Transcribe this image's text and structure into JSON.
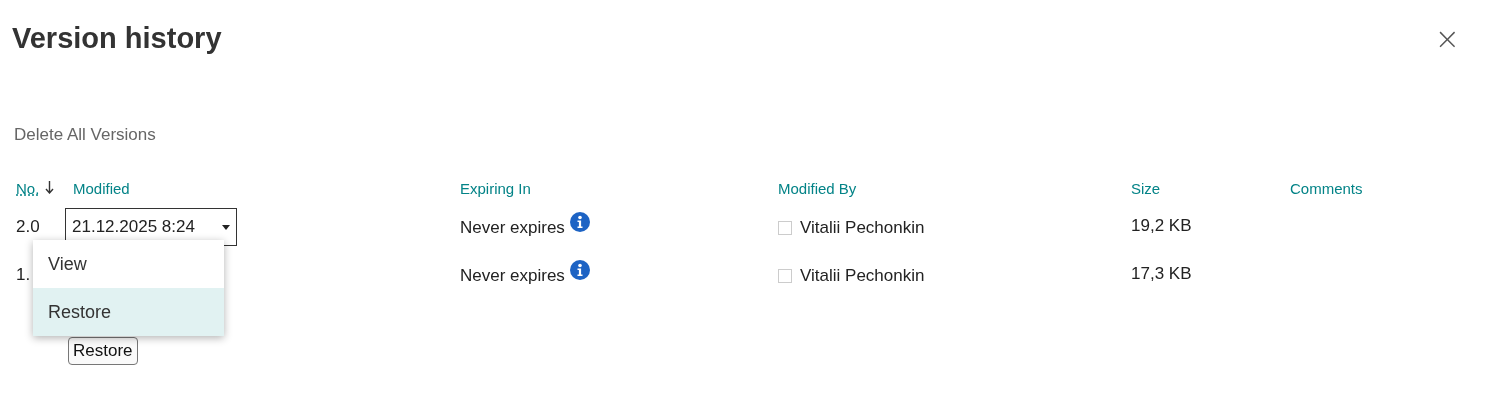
{
  "dialog": {
    "title": "Version history",
    "close_icon": "×"
  },
  "delete_all": "Delete All Versions",
  "columns": [
    {
      "label": "No.",
      "sorted": true
    },
    {
      "label": "Modified",
      "sorted": false
    },
    {
      "label": "Expiring In",
      "sorted": false
    },
    {
      "label": "Modified By",
      "sorted": false
    },
    {
      "label": "Size",
      "sorted": false
    },
    {
      "label": "Comments",
      "sorted": false
    }
  ],
  "rows": [
    {
      "number": "2.0",
      "modified": "21.12.2025 8:24",
      "expiring": "Never expires",
      "modified_by": "Vitalii Pechonkin",
      "checked": false,
      "size": "19,2 KB"
    },
    {
      "number": "1.",
      "modified": "",
      "expiring": "Never expires",
      "modified_by": "Vitalii Pechonkin",
      "checked": false,
      "size": "17,3 KB"
    }
  ],
  "menu": {
    "items": [
      {
        "label": "View",
        "selected": false
      },
      {
        "label": "Restore",
        "selected": true
      }
    ]
  },
  "restore_button": "Restore"
}
